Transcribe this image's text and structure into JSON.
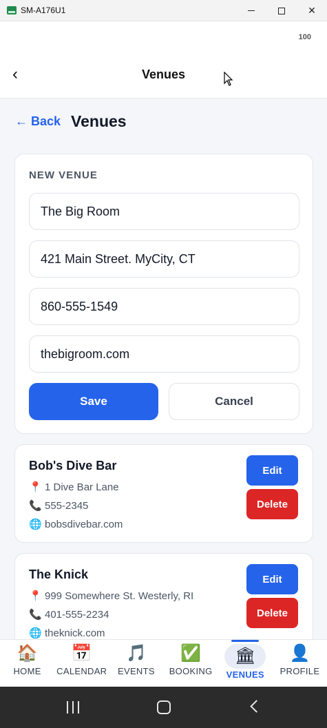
{
  "window": {
    "title": "SM-A176U1",
    "minimize_label": "",
    "maximize_label": "",
    "close_label": "✕"
  },
  "status": {
    "battery": "100"
  },
  "app_header": {
    "back_glyph": "‹",
    "title": "Venues"
  },
  "page": {
    "back_label": "← Back",
    "title": "Venues"
  },
  "new_venue_form": {
    "section_label": "NEW VENUE",
    "name_value": "The Big Room",
    "address_value": "421 Main Street. MyCity, CT",
    "phone_value": "860-555-1549",
    "website_value": "thebigroom.com",
    "save_label": "Save",
    "cancel_label": "Cancel"
  },
  "venues": [
    {
      "name": "Bob's Dive Bar",
      "address": "1 Dive Bar Lane",
      "phone": "555-2345",
      "website": "bobsdivebar.com",
      "edit_label": "Edit",
      "delete_label": "Delete"
    },
    {
      "name": "The Knick",
      "address": "999 Somewhere St. Westerly, RI",
      "phone": "401-555-2234",
      "website": "theknick.com",
      "edit_label": "Edit",
      "delete_label": "Delete"
    }
  ],
  "icons": {
    "address": "📍",
    "phone": "📞",
    "website": "🌐"
  },
  "bottom_nav": [
    {
      "label": "HOME",
      "icon": "🏠",
      "active": false
    },
    {
      "label": "CALENDAR",
      "icon": "📅",
      "active": false
    },
    {
      "label": "EVENTS",
      "icon": "🎵",
      "active": false
    },
    {
      "label": "BOOKING",
      "icon": "✅",
      "active": false
    },
    {
      "label": "VENUES",
      "icon": "🏛",
      "active": true
    },
    {
      "label": "PROFILE",
      "icon": "👤",
      "active": false
    }
  ],
  "colors": {
    "accent": "#2563eb",
    "danger": "#dc2626",
    "background": "#f4f6fa"
  }
}
